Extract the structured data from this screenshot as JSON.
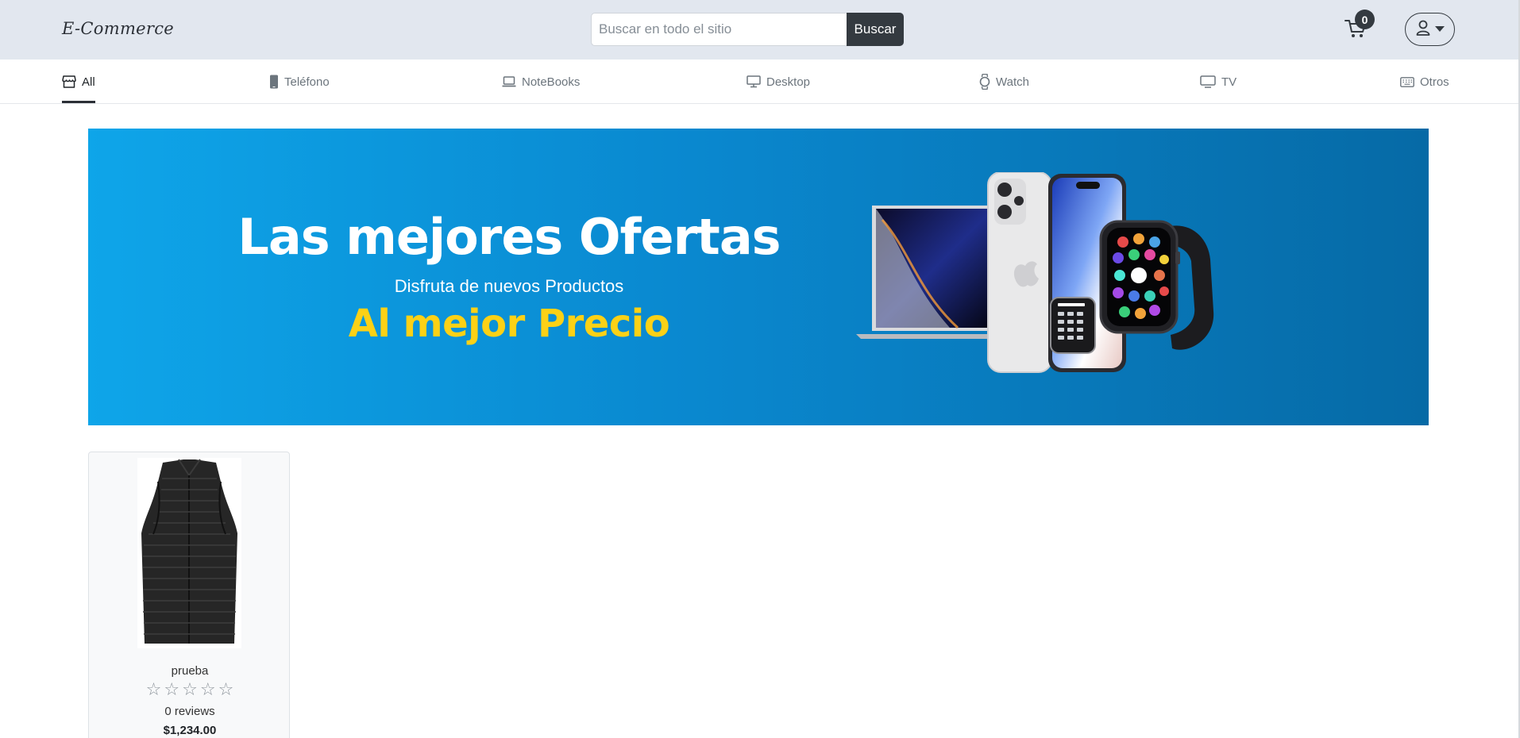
{
  "header": {
    "logo": "E-Commerce",
    "search_placeholder": "Buscar en todo el sitio",
    "search_button": "Buscar",
    "cart_count": "0"
  },
  "nav": {
    "items": [
      {
        "label": "All",
        "icon": "store-icon",
        "active": true
      },
      {
        "label": "Teléfono",
        "icon": "phone-icon",
        "active": false
      },
      {
        "label": "NoteBooks",
        "icon": "laptop-icon",
        "active": false
      },
      {
        "label": "Desktop",
        "icon": "desktop-icon",
        "active": false
      },
      {
        "label": "Watch",
        "icon": "watch-icon",
        "active": false
      },
      {
        "label": "TV",
        "icon": "tv-icon",
        "active": false
      },
      {
        "label": "Otros",
        "icon": "keyboard-icon",
        "active": false
      }
    ]
  },
  "banner": {
    "title": "Las mejores Ofertas",
    "subtitle": "Disfruta de nuevos Productos",
    "price_text": "Al mejor Precio",
    "colors": {
      "bg_start": "#0ea5e9",
      "bg_end": "#066aa6",
      "accent": "#fcd116"
    }
  },
  "products": [
    {
      "name": "prueba",
      "rating": 0,
      "max_rating": 5,
      "reviews": "0 reviews",
      "price": "$1,234.00"
    }
  ]
}
